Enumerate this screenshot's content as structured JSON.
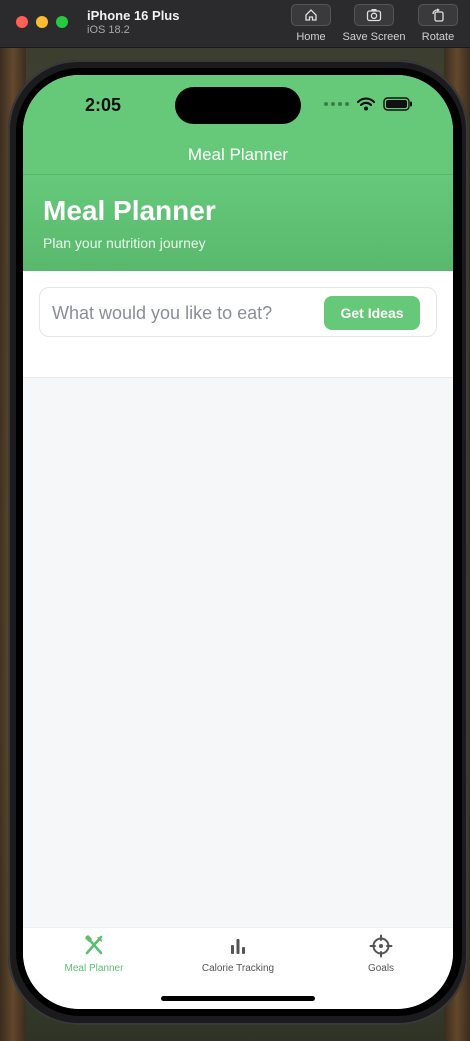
{
  "simulator": {
    "device_name": "iPhone 16 Plus",
    "os_version": "iOS 18.2",
    "buttons": [
      {
        "label": "Home",
        "icon": "home-icon"
      },
      {
        "label": "Save Screen",
        "icon": "camera-icon"
      },
      {
        "label": "Rotate",
        "icon": "rotate-icon"
      }
    ]
  },
  "status_bar": {
    "time": "2:05"
  },
  "nav": {
    "title": "Meal Planner"
  },
  "hero": {
    "title": "Meal Planner",
    "subtitle": "Plan your nutrition journey"
  },
  "search": {
    "placeholder": "What would you like to eat?",
    "value": "",
    "button_label": "Get Ideas"
  },
  "tabbar": {
    "tabs": [
      {
        "label": "Meal Planner",
        "icon": "fork-knife-icon",
        "active": true
      },
      {
        "label": "Calorie Tracking",
        "icon": "bar-chart-icon",
        "active": false
      },
      {
        "label": "Goals",
        "icon": "target-icon",
        "active": false
      }
    ]
  },
  "colors": {
    "accent": "#66c97a",
    "tab_active": "#5cbf70",
    "tab_inactive": "#555555",
    "background": "#f6f7f9"
  }
}
